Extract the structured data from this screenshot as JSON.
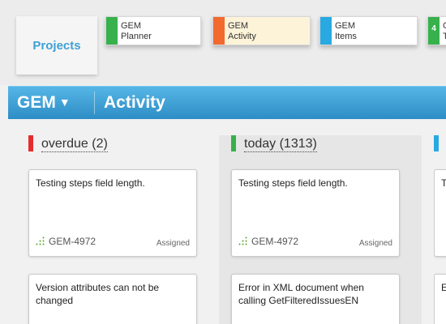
{
  "projects": {
    "label": "Projects"
  },
  "app_tabs": [
    {
      "line1": "GEM",
      "line2": "Planner",
      "color": "#36b14b"
    },
    {
      "line1": "GEM",
      "line2": "Activity",
      "color": "#f26a2e"
    },
    {
      "line1": "GEM",
      "line2": "Items",
      "color": "#29a9e1"
    },
    {
      "line1": "G",
      "line2": "T",
      "color": "#36b14b",
      "badge": "4"
    }
  ],
  "header": {
    "product": "GEM",
    "caret": "▼",
    "title": "Activity"
  },
  "columns": [
    {
      "label": "overdue (2)",
      "color": "#e52d2d",
      "cards": [
        {
          "summary": "Testing steps field length.",
          "key": "GEM-4972",
          "status": "Assigned"
        },
        {
          "summary": "Version attributes can not be changed"
        }
      ]
    },
    {
      "label": "today (1313)",
      "color": "#36b14b",
      "cards": [
        {
          "summary": "Testing steps field length.",
          "key": "GEM-4972",
          "status": "Assigned"
        },
        {
          "summary": "Error in XML document when calling GetFilteredIssuesEN"
        }
      ]
    },
    {
      "color": "#29a9e1",
      "cards": [
        {
          "summary": "T"
        },
        {
          "summary": "E"
        }
      ]
    }
  ]
}
